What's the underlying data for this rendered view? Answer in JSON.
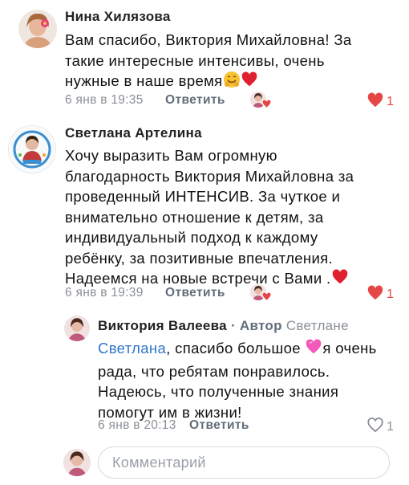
{
  "comments": [
    {
      "author": "Нина Хилязова",
      "lines": [
        "Вам спасибо, Виктория Михайловна! За",
        "такие интересные интенсивы, очень",
        "нужные в наше время"
      ],
      "date": "6 янв в 19:35",
      "reply_label": "Ответить",
      "likes": "1",
      "liked": true
    },
    {
      "author": "Светлана Артелина",
      "lines": [
        "Хочу выразить Вам  огромную",
        "благодарность Виктория Михайловна  за",
        "проведенный ИНТЕНСИВ. За чуткое и",
        "внимательно отношение к детям, за",
        "индивидуальный подход к каждому",
        "ребёнку, за позитивные впечатления.",
        "Надеемся на новые встречи с Вами ."
      ],
      "date": "6 янв в 19:39",
      "reply_label": "Ответить",
      "likes": "1",
      "liked": true
    }
  ],
  "reply": {
    "author": "Виктория Валеева",
    "author_tag": "· Автор",
    "addressee": "Светлане",
    "mention": "Светлана",
    "line1_rest": ", спасибо большое",
    "line1_after": "я очень",
    "lines": [
      "рада, что ребятам понравилось.",
      "Надеюсь, что полученные знания",
      "помогут им в жизни!"
    ],
    "date": "6 янв в 20:13",
    "reply_label": "Ответить",
    "likes": "1",
    "liked": false
  },
  "composer": {
    "placeholder": "Комментарий"
  },
  "colors": {
    "link": "#2f75c8",
    "like_red": "#e64646",
    "muted": "#8a8f96"
  }
}
